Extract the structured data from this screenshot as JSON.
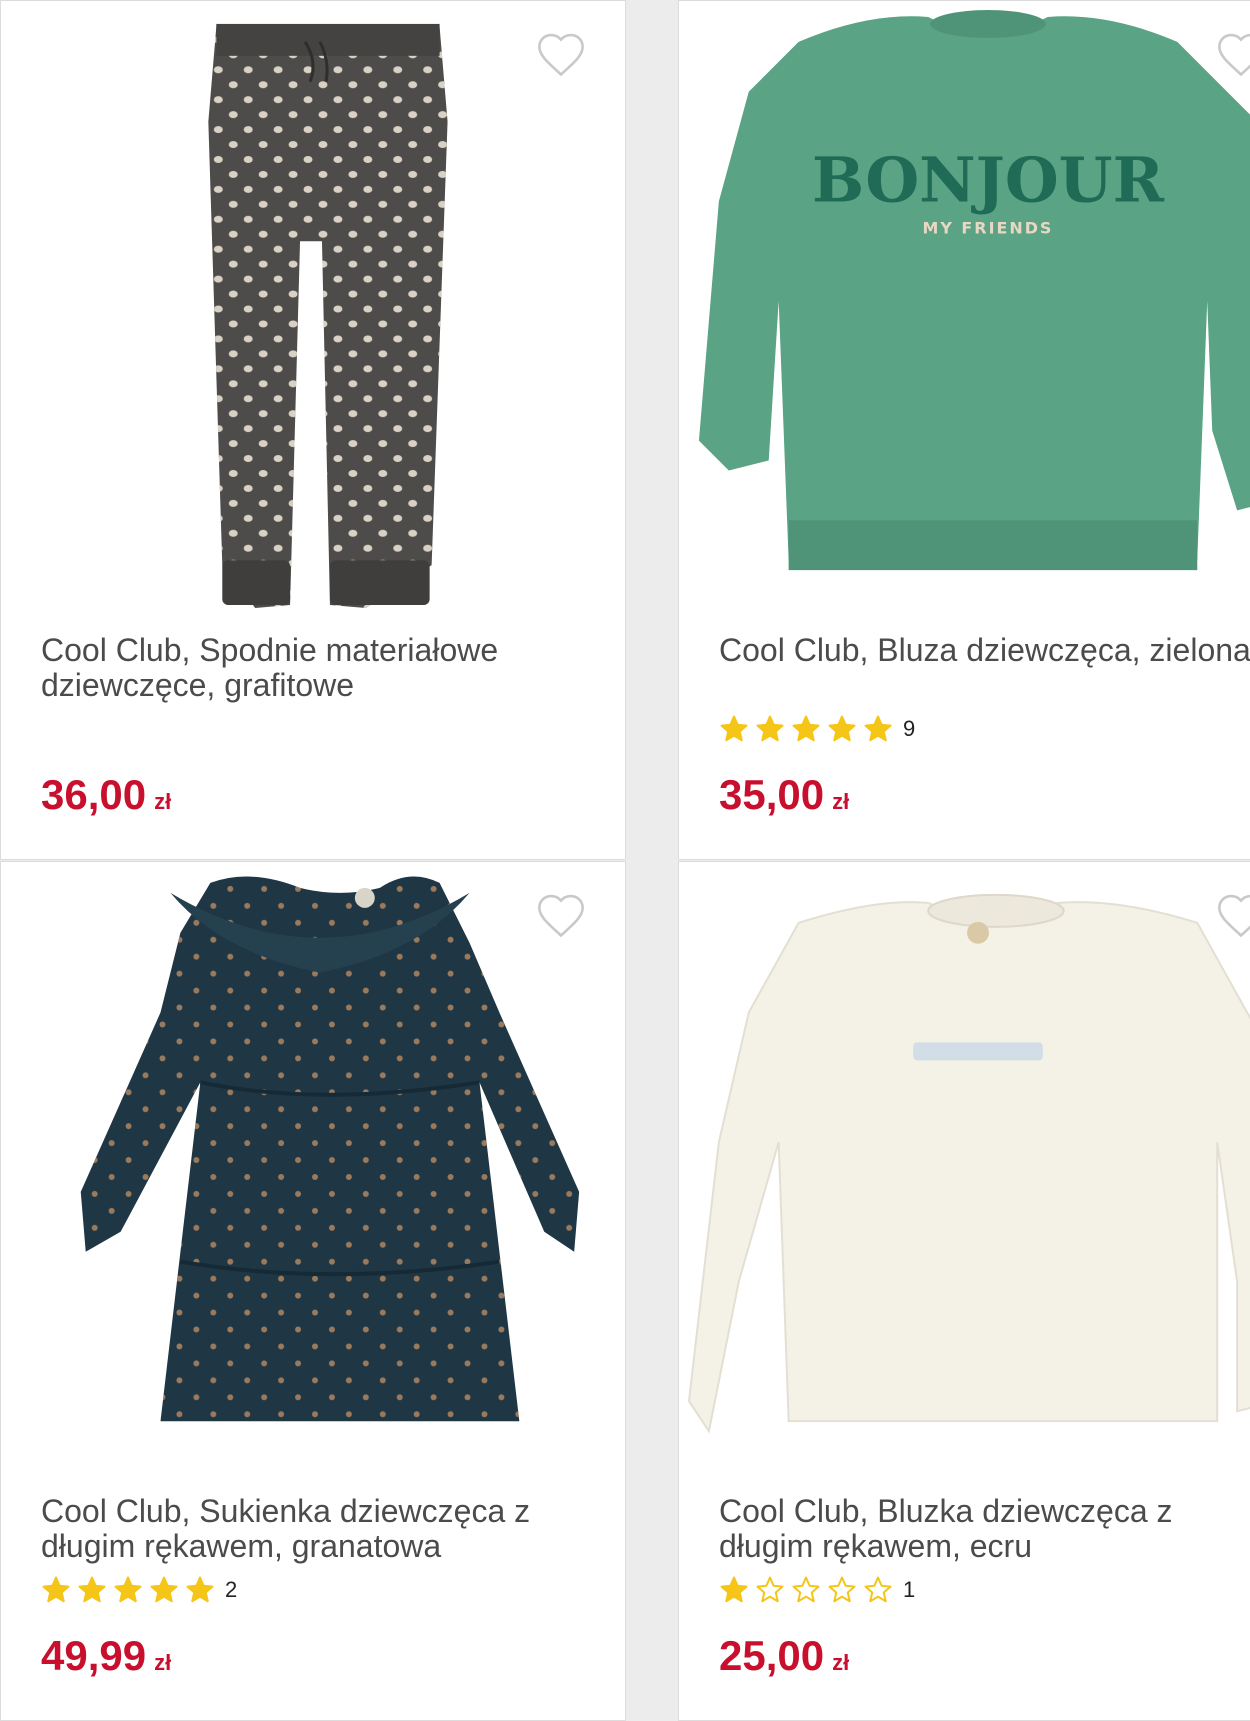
{
  "products": [
    {
      "title": "Cool Club, Spodnie materiałowe dziewczęce, grafitowe",
      "price": "36,00",
      "currency": "zł",
      "image": "grey-polka-dot-trousers",
      "rating": null
    },
    {
      "title": "Cool Club, Bluza dziewczęca, zielona",
      "price": "35,00",
      "currency": "zł",
      "image": "green-sweatshirt",
      "print_main": "BONJOUR",
      "print_sub": "MY FRIENDS",
      "rating": {
        "stars": 5,
        "count": "9"
      }
    },
    {
      "title": "Cool Club, Sukienka dziewczęca z długim rękawem, granatowa",
      "price": "49,99",
      "currency": "zł",
      "image": "navy-dotted-dress",
      "rating": {
        "stars": 5,
        "count": "2"
      }
    },
    {
      "title": "Cool Club, Bluzka dziewczęca z długim rękawem, ecru",
      "price": "25,00",
      "currency": "zł",
      "image": "ecru-long-sleeve-top",
      "rating": {
        "stars": 1,
        "count": "1"
      }
    }
  ],
  "icons": {
    "wishlist": "heart-outline-icon",
    "star_filled": "star-filled-icon",
    "star_empty": "star-outline-icon"
  },
  "colors": {
    "price": "#c8102e",
    "star": "#f5c518",
    "title": "#4b4b4b"
  }
}
